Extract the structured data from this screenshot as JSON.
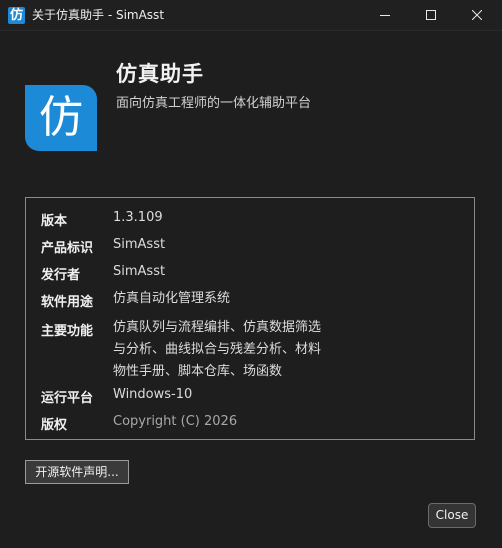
{
  "window": {
    "title": "关于仿真助手 - SimAsst",
    "app_icon_glyph": "仿"
  },
  "header": {
    "logo_glyph": "仿",
    "app_name": "仿真助手",
    "description": "面向仿真工程师的一体化辅助平台"
  },
  "info": {
    "rows": [
      {
        "label": "版本",
        "value": "1.3.109"
      },
      {
        "label": "产品标识",
        "value": "SimAsst"
      },
      {
        "label": "发行者",
        "value": "SimAsst"
      },
      {
        "label": "软件用途",
        "value": "仿真自动化管理系统"
      },
      {
        "label": "主要功能",
        "value": "仿真队列与流程编排、仿真数据筛选与分析、曲线拟合与残差分析、材料物性手册、脚本仓库、场函数"
      },
      {
        "label": "运行平台",
        "value": "Windows-10"
      },
      {
        "label": "版权",
        "value": "Copyright (C) 2026"
      }
    ]
  },
  "buttons": {
    "license_label": "开源软件声明...",
    "close_label": "Close"
  },
  "colors": {
    "accent": "#1c8ad6",
    "background": "#1e1e1e",
    "border": "#8a8a8a"
  },
  "icons": {
    "minimize": "minimize-icon",
    "maximize": "maximize-icon",
    "close": "close-icon"
  }
}
